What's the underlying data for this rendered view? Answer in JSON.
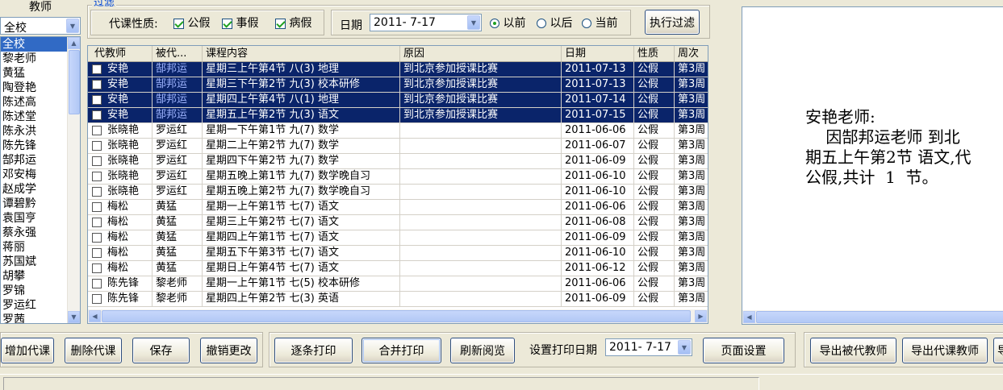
{
  "teacher_panel": {
    "header": "教师",
    "dropdown_value": "全校",
    "items": [
      "全校",
      "黎老师",
      "黄猛",
      "陶登艳",
      "陈述高",
      "陈述堂",
      "陈永洪",
      "陈先锋",
      "郜邦运",
      "邓安梅",
      "赵成学",
      "谭碧黔",
      "袁国亨",
      "蔡永强",
      "蒋丽",
      "苏国斌",
      "胡攀",
      "罗锦",
      "罗运红",
      "罗茜"
    ],
    "selected_index": 0
  },
  "filter": {
    "group_label": "过滤",
    "type_label": "代课性质:",
    "types": [
      {
        "label": "公假",
        "checked": true
      },
      {
        "label": "事假",
        "checked": true
      },
      {
        "label": "病假",
        "checked": true
      }
    ],
    "date_label": "日期",
    "date_value": "2011- 7-17",
    "options": [
      {
        "label": "以前",
        "selected": true
      },
      {
        "label": "以后",
        "selected": false
      },
      {
        "label": "当前",
        "selected": false
      }
    ],
    "run_button": "执行过滤"
  },
  "grid": {
    "columns": [
      "代教师",
      "被代...",
      "课程内容",
      "原因",
      "日期",
      "性质",
      "周次"
    ],
    "rows": [
      {
        "sub": "安艳",
        "orig": "郜邦运",
        "course": "星期三上午第4节 八(3) 地理",
        "reason": "到北京参加授课比赛",
        "date": "2011-07-13",
        "type": "公假",
        "week": "第3周",
        "selected": true
      },
      {
        "sub": "安艳",
        "orig": "郜邦运",
        "course": "星期三下午第2节 九(3) 校本研修",
        "reason": "到北京参加授课比赛",
        "date": "2011-07-13",
        "type": "公假",
        "week": "第3周",
        "selected": true
      },
      {
        "sub": "安艳",
        "orig": "郜邦运",
        "course": "星期四上午第4节 八(1) 地理",
        "reason": "到北京参加授课比赛",
        "date": "2011-07-14",
        "type": "公假",
        "week": "第3周",
        "selected": true
      },
      {
        "sub": "安艳",
        "orig": "郜邦运",
        "course": "星期五上午第2节 九(3) 语文",
        "reason": "到北京参加授课比赛",
        "date": "2011-07-15",
        "type": "公假",
        "week": "第3周",
        "selected": true
      },
      {
        "sub": "张晓艳",
        "orig": "罗运红",
        "course": "星期一下午第1节 九(7) 数学",
        "reason": "",
        "date": "2011-06-06",
        "type": "公假",
        "week": "第3周",
        "selected": false
      },
      {
        "sub": "张晓艳",
        "orig": "罗运红",
        "course": "星期二上午第2节 九(7) 数学",
        "reason": "",
        "date": "2011-06-07",
        "type": "公假",
        "week": "第3周",
        "selected": false
      },
      {
        "sub": "张晓艳",
        "orig": "罗运红",
        "course": "星期四下午第2节 九(7) 数学",
        "reason": "",
        "date": "2011-06-09",
        "type": "公假",
        "week": "第3周",
        "selected": false
      },
      {
        "sub": "张晓艳",
        "orig": "罗运红",
        "course": "星期五晚上第1节 九(7) 数学晚自习",
        "reason": "",
        "date": "2011-06-10",
        "type": "公假",
        "week": "第3周",
        "selected": false
      },
      {
        "sub": "张晓艳",
        "orig": "罗运红",
        "course": "星期五晚上第2节 九(7) 数学晚自习",
        "reason": "",
        "date": "2011-06-10",
        "type": "公假",
        "week": "第3周",
        "selected": false
      },
      {
        "sub": "梅松",
        "orig": "黄猛",
        "course": "星期一上午第1节 七(7) 语文",
        "reason": "",
        "date": "2011-06-06",
        "type": "公假",
        "week": "第3周",
        "selected": false
      },
      {
        "sub": "梅松",
        "orig": "黄猛",
        "course": "星期三上午第2节 七(7) 语文",
        "reason": "",
        "date": "2011-06-08",
        "type": "公假",
        "week": "第3周",
        "selected": false
      },
      {
        "sub": "梅松",
        "orig": "黄猛",
        "course": "星期四上午第1节 七(7) 语文",
        "reason": "",
        "date": "2011-06-09",
        "type": "公假",
        "week": "第3周",
        "selected": false
      },
      {
        "sub": "梅松",
        "orig": "黄猛",
        "course": "星期五下午第3节 七(7) 语文",
        "reason": "",
        "date": "2011-06-10",
        "type": "公假",
        "week": "第3周",
        "selected": false
      },
      {
        "sub": "梅松",
        "orig": "黄猛",
        "course": "星期日上午第4节 七(7) 语文",
        "reason": "",
        "date": "2011-06-12",
        "type": "公假",
        "week": "第3周",
        "selected": false
      },
      {
        "sub": "陈先锋",
        "orig": "黎老师",
        "course": "星期一上午第1节 七(5) 校本研修",
        "reason": "",
        "date": "2011-06-06",
        "type": "公假",
        "week": "第3周",
        "selected": false
      },
      {
        "sub": "陈先锋",
        "orig": "黎老师",
        "course": "星期四上午第2节 七(3) 英语",
        "reason": "",
        "date": "2011-06-09",
        "type": "公假",
        "week": "第3周",
        "selected": false
      }
    ]
  },
  "preview": {
    "text": "安艳老师:\n    因郜邦运老师 到北\n期五上午第2节 语文,代\n公假,共计  1  节。"
  },
  "toolbar": {
    "add": "增加代课",
    "delete": "删除代课",
    "save": "保存",
    "undo": "撤销更改",
    "print_each": "逐条打印",
    "print_merged": "合并打印",
    "refresh": "刷新阅览",
    "print_date_label": "设置打印日期",
    "print_date_value": "2011- 7-17",
    "page_setup": "页面设置",
    "export_orig": "导出被代教师",
    "export_sub": "导出代课教师",
    "export_more": "导"
  }
}
